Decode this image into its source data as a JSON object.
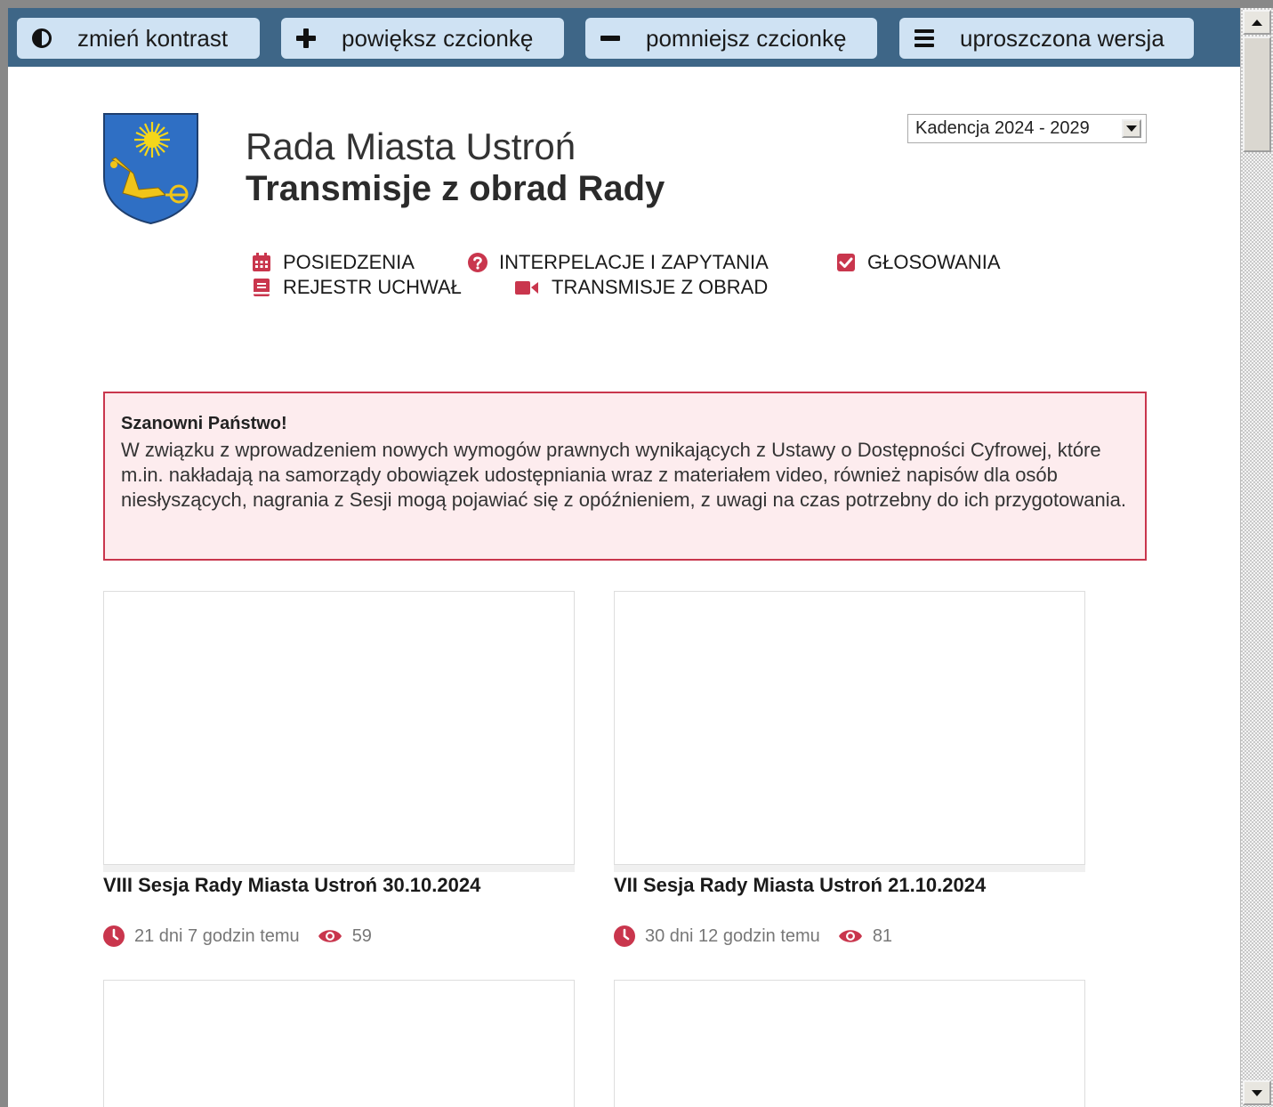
{
  "toolbar": {
    "contrast": "zmień kontrast",
    "bigger_font": "powiększ czcionkę",
    "smaller_font": "pomniejsz czcionkę",
    "simple_version": "uproszczona wersja"
  },
  "header": {
    "title": "Rada Miasta Ustroń",
    "subtitle": "Transmisje z obrad Rady",
    "term_select": "Kadencja 2024 - 2029"
  },
  "nav": {
    "sessions": "POSIEDZENIA",
    "interpellations": "INTERPELACJE I ZAPYTANIA",
    "votes": "GŁOSOWANIA",
    "resolutions": "REJESTR UCHWAŁ",
    "broadcasts": "TRANSMISJE Z OBRAD"
  },
  "notice": {
    "title": "Szanowni Państwo!",
    "text": "W związku z wprowadzeniem nowych wymogów prawnych wynikających z Ustawy o Dostępności Cyfrowej, które m.in. nakładają na samorządy obowiązek udostępniania wraz z materiałem video, również napisów dla osób niesłyszących, nagrania z Sesji mogą pojawiać się z opóźnieniem, z uwagi na czas potrzebny do ich przygotowania."
  },
  "videos": [
    {
      "title": "VIII Sesja Rady Miasta Ustroń 30.10.2024",
      "age": "21 dni 7 godzin temu",
      "views": "59"
    },
    {
      "title": "VII Sesja Rady Miasta Ustroń 21.10.2024",
      "age": "30 dni 12 godzin temu",
      "views": "81"
    }
  ],
  "colors": {
    "toolbar_bg": "#3e6687",
    "button_bg": "#cfe2f3",
    "accent": "#c9364d",
    "notice_bg": "#fdecee"
  }
}
